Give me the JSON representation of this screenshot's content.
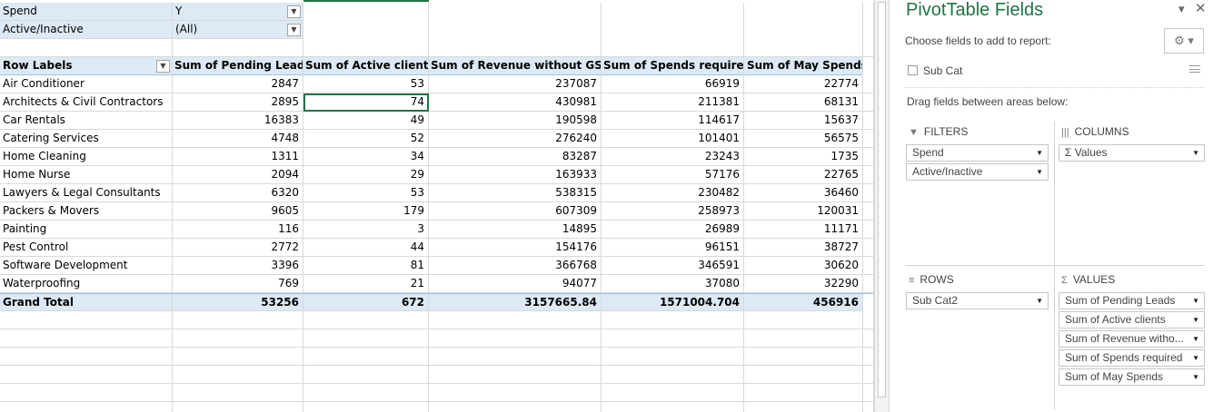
{
  "filters": [
    {
      "label": "Spend",
      "value": "Y",
      "icon": "filter-applied-icon"
    },
    {
      "label": "Active/Inactive",
      "value": "(All)",
      "icon": "chevron-down-icon"
    }
  ],
  "pivot": {
    "row_labels_header": "Row Labels",
    "columns": [
      "Sum of Pending Leads",
      "Sum of Active clients",
      "Sum of Revenue without GST",
      "Sum of Spends required",
      "Sum of May Spends"
    ],
    "rows": [
      {
        "label": "Air Conditioner",
        "values": [
          "2847",
          "53",
          "237087",
          "66919",
          "22774"
        ]
      },
      {
        "label": "Architects & Civil Contractors",
        "values": [
          "2895",
          "74",
          "430981",
          "211381",
          "68131"
        ]
      },
      {
        "label": "Car Rentals",
        "values": [
          "16383",
          "49",
          "190598",
          "114617",
          "15637"
        ]
      },
      {
        "label": "Catering Services",
        "values": [
          "4748",
          "52",
          "276240",
          "101401",
          "56575"
        ]
      },
      {
        "label": "Home Cleaning",
        "values": [
          "1311",
          "34",
          "83287",
          "23243",
          "1735"
        ]
      },
      {
        "label": "Home Nurse",
        "values": [
          "2094",
          "29",
          "163933",
          "57176",
          "22765"
        ]
      },
      {
        "label": "Lawyers & Legal Consultants",
        "values": [
          "6320",
          "53",
          "538315",
          "230482",
          "36460"
        ]
      },
      {
        "label": "Packers & Movers",
        "values": [
          "9605",
          "179",
          "607309",
          "258973",
          "120031"
        ]
      },
      {
        "label": "Painting",
        "values": [
          "116",
          "3",
          "14895",
          "26989",
          "11171"
        ]
      },
      {
        "label": "Pest Control",
        "values": [
          "2772",
          "44",
          "154176",
          "96151",
          "38727"
        ]
      },
      {
        "label": "Software Development",
        "values": [
          "3396",
          "81",
          "366768",
          "346591",
          "30620"
        ]
      },
      {
        "label": "Waterproofing",
        "values": [
          "769",
          "21",
          "94077",
          "37080",
          "32290"
        ]
      }
    ],
    "grand_total": {
      "label": "Grand Total",
      "values": [
        "53256",
        "672",
        "3157665.84",
        "1571004.704",
        "456916"
      ]
    }
  },
  "pane": {
    "title": "PivotTable Fields",
    "choose_label": "Choose fields to add to report:",
    "field_list": [
      {
        "label": "Sub Cat",
        "checked": false
      }
    ],
    "drag_label": "Drag fields between areas below:",
    "areas": {
      "filters": {
        "title": "FILTERS",
        "items": [
          "Spend",
          "Active/Inactive"
        ]
      },
      "columns": {
        "title": "COLUMNS",
        "items": [
          "Σ Values"
        ]
      },
      "rows": {
        "title": "ROWS",
        "items": [
          "Sub Cat2"
        ]
      },
      "values": {
        "title": "VALUES",
        "items": [
          "Sum of Pending Leads",
          "Sum of Active clients",
          "Sum of Revenue witho...",
          "Sum of Spends required",
          "Sum of May Spends"
        ]
      }
    }
  },
  "colors": {
    "accent": "#217346",
    "pivot_header_fill": "#dde9f5"
  }
}
